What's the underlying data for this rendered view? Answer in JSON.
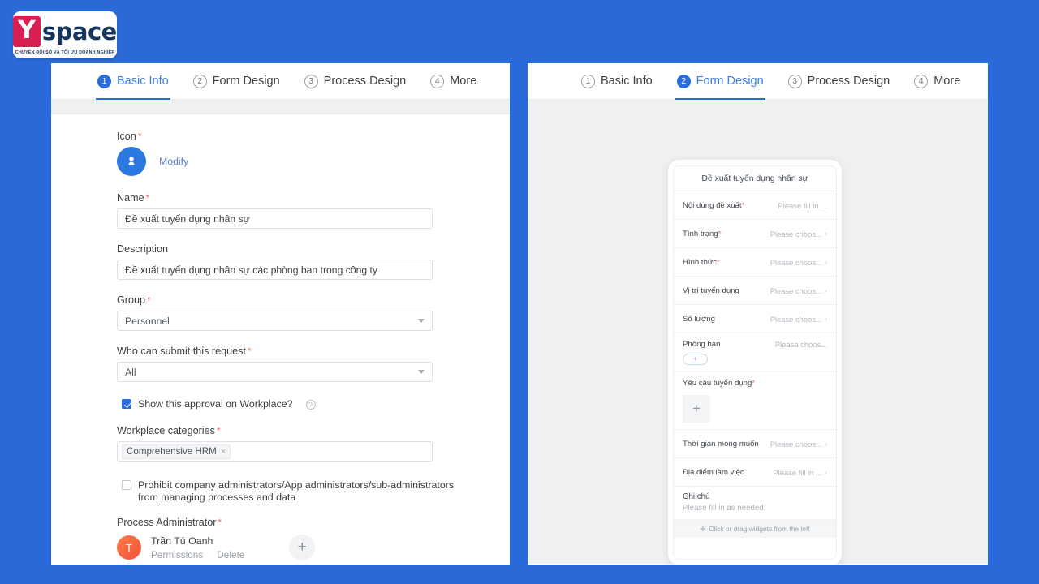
{
  "brand": {
    "mark": "Y",
    "name": "space",
    "tagline": "CHUYỂN ĐỔI SỐ VÀ TỐI ƯU DOANH NGHIỆP",
    "mark_color": "#d81f52",
    "name_color": "#17365d",
    "background_color": "#2a6ad8"
  },
  "tabs": [
    {
      "num": "1",
      "label": "Basic Info"
    },
    {
      "num": "2",
      "label": "Form Design"
    },
    {
      "num": "3",
      "label": "Process Design"
    },
    {
      "num": "4",
      "label": "More"
    }
  ],
  "left_panel": {
    "active_tab": "Basic Info",
    "icon": {
      "label": "Icon",
      "required": "*",
      "modify_label": "Modify",
      "icon_name": "user-avatar-icon",
      "color": "#2b79e0"
    },
    "name": {
      "label": "Name",
      "required": "*",
      "value": "Đề xuất tuyển dụng nhân sự"
    },
    "description": {
      "label": "Description",
      "value": "Đề xuất tuyển dụng nhân sự các phòng ban trong công ty"
    },
    "group": {
      "label": "Group",
      "required": "*",
      "value": "Personnel"
    },
    "who_can_submit": {
      "label": "Who can submit this request",
      "required": "*",
      "value": "All"
    },
    "show_on_workplace": {
      "label": "Show this approval on Workplace?",
      "checked": true,
      "help": "?"
    },
    "workplace_categories": {
      "label": "Workplace categories",
      "required": "*",
      "tags": [
        "Comprehensive HRM"
      ],
      "remove_glyph": "×"
    },
    "prohibit_admins": {
      "line1": "Prohibit company administrators/App administrators/sub-administrators",
      "line2": "from managing processes and data",
      "checked": false
    },
    "process_administrator": {
      "label": "Process Administrator",
      "required": "*",
      "avatar_initial": "T",
      "name": "Trần Tú Oanh",
      "permissions_label": "Permissions",
      "delete_label": "Delete",
      "add_glyph": "+"
    }
  },
  "right_panel": {
    "active_tab": "Form Design",
    "form_preview": {
      "title": "Đề xuất tuyển dụng nhân sự",
      "rows": [
        {
          "type": "row",
          "key": "Nội dung đề xuất",
          "required": true,
          "value": "Please fill in ...",
          "chevron": false
        },
        {
          "type": "row",
          "key": "Tình trạng",
          "required": true,
          "value": "Please choos...",
          "chevron": true
        },
        {
          "type": "row",
          "key": "Hình thức",
          "required": true,
          "value": "Please choos...",
          "chevron": true
        },
        {
          "type": "row",
          "key": "Vị trí tuyển dụng",
          "required": false,
          "value": "Please choos...",
          "chevron": true
        },
        {
          "type": "row",
          "key": "Số lượng",
          "required": false,
          "value": "Please choos...",
          "chevron": true
        },
        {
          "type": "pill",
          "key": "Phòng ban",
          "required": false,
          "value": "Please choos...",
          "glyph": "+"
        },
        {
          "type": "box",
          "key": "Yêu cầu tuyển dụng",
          "required": true,
          "value": "",
          "glyph": "+"
        },
        {
          "type": "row",
          "key": "Thời gian mong muốn",
          "required": false,
          "value": "Please choos...",
          "chevron": true
        },
        {
          "type": "row",
          "key": "Địa điểm làm việc",
          "required": false,
          "value": "Please fill in ...",
          "chevron": true
        }
      ],
      "note": {
        "key": "Ghi chú",
        "value": "Please fill in as needed."
      },
      "drag_hint": {
        "glyph": "✛",
        "text": "Click or drag widgets from the left"
      }
    }
  }
}
